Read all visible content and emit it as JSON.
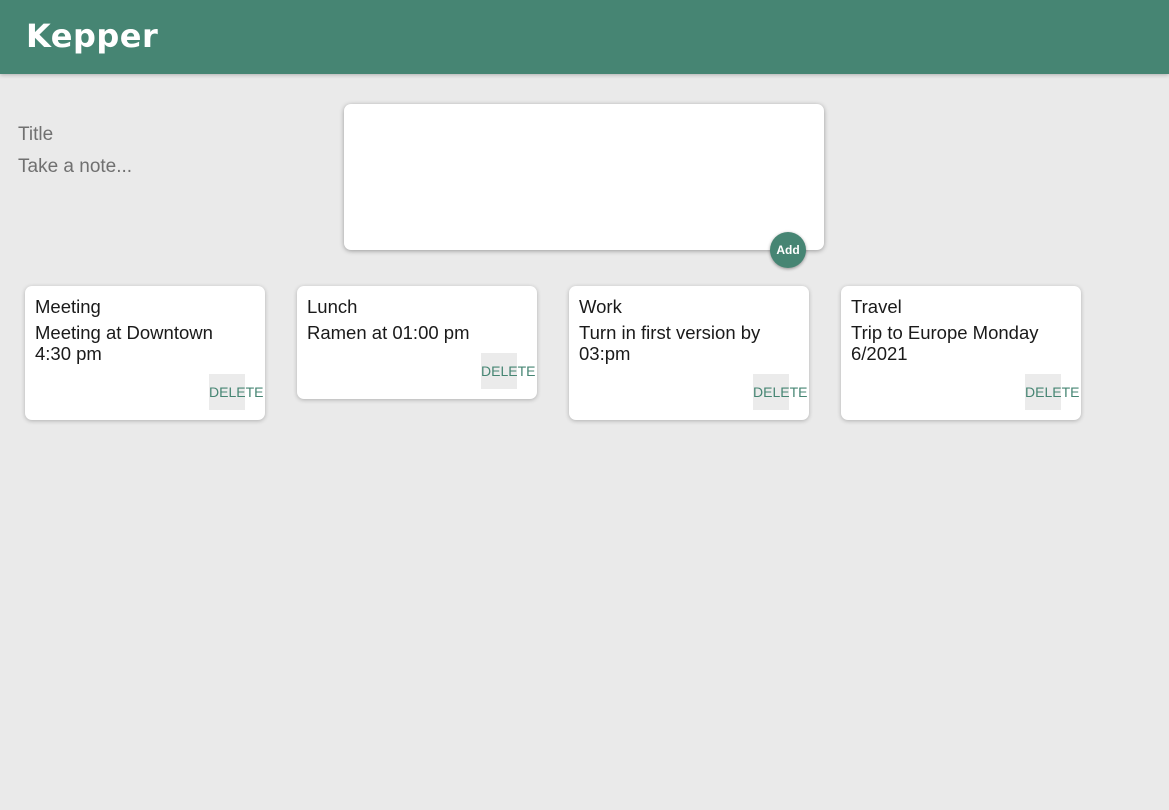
{
  "header": {
    "title": "Kepper",
    "background_color": "#468573"
  },
  "create_area": {
    "title_placeholder": "Title",
    "content_placeholder": "Take a note...",
    "add_label": "Add"
  },
  "notes": [
    {
      "title": "Meeting",
      "content": "Meeting at Downtown 4:30 pm",
      "delete_label": "DELETE"
    },
    {
      "title": "Lunch",
      "content": "Ramen at 01:00 pm",
      "delete_label": "DELETE"
    },
    {
      "title": "Work",
      "content": "Turn in first version by 03:pm",
      "delete_label": "DELETE"
    },
    {
      "title": "Travel",
      "content": "Trip to Europe Monday 6/2021",
      "delete_label": "DELETE"
    }
  ],
  "colors": {
    "accent": "#468573",
    "page_background": "#eaeaea",
    "card_background": "#ffffff"
  }
}
